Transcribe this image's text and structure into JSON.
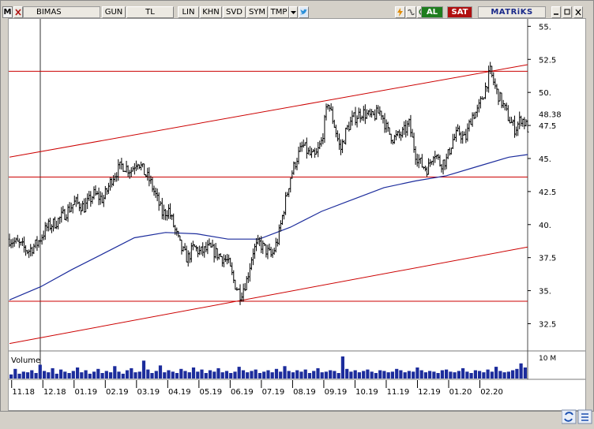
{
  "toolbar": {
    "menu_letter": "M",
    "symbol": "BIMAS",
    "buttons": [
      "GUN",
      "TL",
      "LIN",
      "KHN",
      "SVD",
      "SYM",
      "TMP"
    ],
    "buy": "AL",
    "sell": "SAT",
    "brand": "MATRiKS"
  },
  "colors": {
    "price": "#000000",
    "moving_average": "#1c2c9c",
    "trend_lines": "#cc0000",
    "volume": "#1c2c9c",
    "buy": "#1e7d1e",
    "sell": "#b01010"
  },
  "chart_data": [
    {
      "type": "bar",
      "subtype": "ohlc",
      "symbol": "BIMAS",
      "price_axis_labels": [
        "55.",
        "52.5",
        "50.",
        "47.5",
        "45.",
        "42.5",
        "40.",
        "37.5",
        "35.",
        "32.5"
      ],
      "last_value_label": "48.38",
      "time_axis_labels": [
        "11.18",
        "12.18",
        "01.19",
        "02.19",
        "03.19",
        "04.19",
        "05.19",
        "06.19",
        "07.19",
        "08.19",
        "09.19",
        "10.19",
        "11.19",
        "12.19",
        "01.20",
        "02.20"
      ],
      "ylim": [
        30.5,
        55.5
      ],
      "xlim": [
        0,
        16.6
      ],
      "price_path": [
        [
          0.0,
          38.9
        ],
        [
          0.3,
          38.5
        ],
        [
          0.6,
          38.0
        ],
        [
          0.9,
          38.6
        ],
        [
          1.2,
          39.8
        ],
        [
          1.5,
          40.2
        ],
        [
          1.8,
          40.9
        ],
        [
          2.1,
          41.7
        ],
        [
          2.4,
          41.3
        ],
        [
          2.7,
          42.3
        ],
        [
          3.0,
          41.9
        ],
        [
          3.3,
          43.6
        ],
        [
          3.6,
          44.5
        ],
        [
          3.9,
          44.1
        ],
        [
          4.1,
          44.9
        ],
        [
          4.3,
          44.0
        ],
        [
          4.5,
          43.3
        ],
        [
          4.7,
          42.1
        ],
        [
          4.9,
          40.8
        ],
        [
          5.1,
          41.1
        ],
        [
          5.3,
          39.6
        ],
        [
          5.5,
          38.2
        ],
        [
          5.7,
          37.4
        ],
        [
          5.9,
          38.3
        ],
        [
          6.1,
          37.9
        ],
        [
          6.4,
          38.2
        ],
        [
          6.7,
          37.7
        ],
        [
          7.0,
          37.2
        ],
        [
          7.2,
          35.6
        ],
        [
          7.4,
          34.7
        ],
        [
          7.6,
          35.8
        ],
        [
          7.8,
          38.0
        ],
        [
          8.0,
          38.6
        ],
        [
          8.2,
          38.1
        ],
        [
          8.4,
          37.6
        ],
        [
          8.6,
          38.9
        ],
        [
          8.8,
          41.3
        ],
        [
          9.0,
          43.6
        ],
        [
          9.2,
          45.0
        ],
        [
          9.4,
          46.0
        ],
        [
          9.6,
          45.3
        ],
        [
          9.8,
          45.1
        ],
        [
          10.0,
          46.3
        ],
        [
          10.2,
          49.3
        ],
        [
          10.4,
          47.6
        ],
        [
          10.6,
          45.6
        ],
        [
          10.8,
          47.2
        ],
        [
          11.0,
          48.0
        ],
        [
          11.3,
          48.5
        ],
        [
          11.6,
          48.1
        ],
        [
          11.9,
          48.6
        ],
        [
          12.1,
          47.1
        ],
        [
          12.3,
          46.5
        ],
        [
          12.6,
          46.9
        ],
        [
          12.8,
          47.6
        ],
        [
          13.0,
          45.4
        ],
        [
          13.2,
          44.5
        ],
        [
          13.4,
          44.2
        ],
        [
          13.6,
          45.6
        ],
        [
          13.8,
          44.6
        ],
        [
          14.0,
          44.9
        ],
        [
          14.2,
          46.4
        ],
        [
          14.4,
          47.0
        ],
        [
          14.6,
          46.4
        ],
        [
          14.8,
          48.2
        ],
        [
          15.0,
          48.6
        ],
        [
          15.2,
          50.0
        ],
        [
          15.4,
          51.6
        ],
        [
          15.6,
          50.1
        ],
        [
          15.8,
          49.1
        ],
        [
          16.0,
          48.0
        ],
        [
          16.2,
          47.2
        ],
        [
          16.4,
          48.1
        ],
        [
          16.6,
          47.3
        ]
      ],
      "series": [
        {
          "values": [
            [
              0.0,
              34.3
            ],
            [
              1.0,
              35.3
            ],
            [
              2.0,
              36.6
            ],
            [
              3.0,
              37.8
            ],
            [
              4.0,
              39.0
            ],
            [
              5.0,
              39.4
            ],
            [
              6.0,
              39.3
            ],
            [
              7.0,
              38.9
            ],
            [
              8.0,
              38.9
            ],
            [
              9.0,
              39.8
            ],
            [
              10.0,
              41.0
            ],
            [
              11.0,
              41.9
            ],
            [
              12.0,
              42.8
            ],
            [
              13.0,
              43.3
            ],
            [
              14.0,
              43.7
            ],
            [
              15.0,
              44.4
            ],
            [
              16.0,
              45.1
            ],
            [
              16.6,
              45.3
            ]
          ]
        }
      ],
      "horizontal_levels": [
        51.6,
        43.6,
        34.2
      ],
      "trend_lines": [
        {
          "from": [
            0.0,
            45.1
          ],
          "to": [
            16.6,
            52.1
          ]
        },
        {
          "from": [
            0.0,
            31.0
          ],
          "to": [
            16.6,
            38.3
          ]
        }
      ],
      "grid": false
    },
    {
      "type": "bar",
      "title": "Volume",
      "axis_labels": [
        "10 M"
      ],
      "x": [
        0,
        16.6
      ],
      "values": [
        0.6,
        1.4,
        0.7,
        1.0,
        0.9,
        1.2,
        0.8,
        2.0,
        1.1,
        0.9,
        1.5,
        0.7,
        1.3,
        1.0,
        0.8,
        1.1,
        1.6,
        0.9,
        1.2,
        0.7,
        1.0,
        1.4,
        0.8,
        1.1,
        0.9,
        1.8,
        1.0,
        0.7,
        1.2,
        1.5,
        0.9,
        1.0,
        2.6,
        1.3,
        0.8,
        1.1,
        1.9,
        0.9,
        1.2,
        1.0,
        0.8,
        1.4,
        1.1,
        0.9,
        1.6,
        1.0,
        1.3,
        0.8,
        1.2,
        1.0,
        1.5,
        0.9,
        1.1,
        0.8,
        1.0,
        1.7,
        1.2,
        0.9,
        1.1,
        1.3,
        0.8,
        1.0,
        1.2,
        0.9,
        1.4,
        1.0,
        1.8,
        1.1,
        0.9,
        1.2,
        1.0,
        1.3,
        0.8,
        1.1,
        1.5,
        0.9,
        1.0,
        1.2,
        1.1,
        0.8,
        3.2,
        1.4,
        1.0,
        1.2,
        0.9,
        1.1,
        1.3,
        1.0,
        0.8,
        1.2,
        1.1,
        0.9,
        1.0,
        1.4,
        1.2,
        0.9,
        1.1,
        1.0,
        1.6,
        1.2,
        0.9,
        1.1,
        1.0,
        0.8,
        1.2,
        1.3,
        1.0,
        0.9,
        1.1,
        1.5,
        1.0,
        0.8,
        1.2,
        1.1,
        0.9,
        1.3,
        1.0,
        1.7,
        1.1,
        0.9,
        1.0,
        1.2,
        1.4,
        2.2,
        1.6
      ]
    }
  ]
}
